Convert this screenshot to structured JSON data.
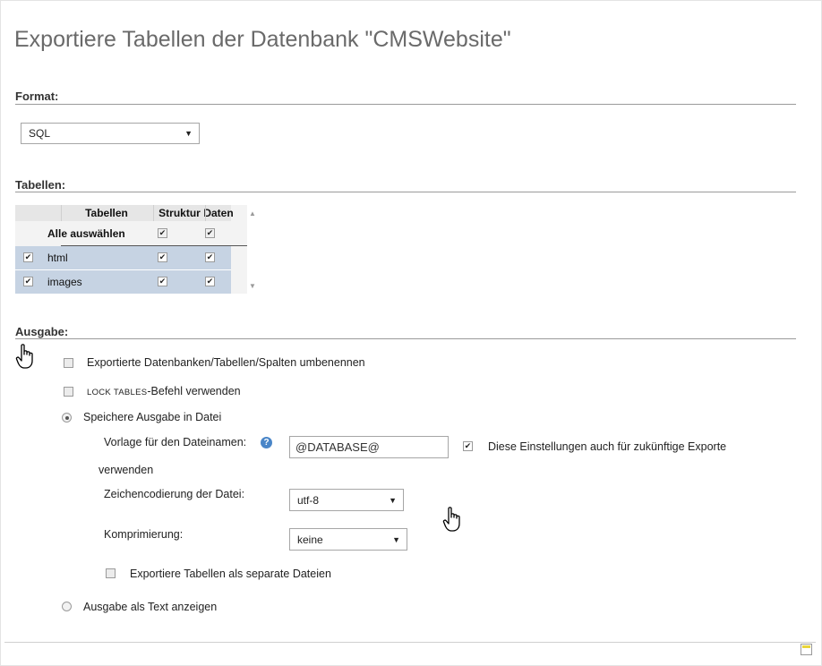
{
  "page": {
    "title": "Exportiere Tabellen der Datenbank \"CMSWebsite\""
  },
  "format": {
    "label": "Format:",
    "selected": "SQL"
  },
  "tables": {
    "label": "Tabellen:",
    "columns": [
      "Tabellen",
      "Struktur",
      "Daten"
    ],
    "select_all_label": "Alle auswählen",
    "rows": [
      {
        "name": "html",
        "selected": true,
        "structure": true,
        "data": true
      },
      {
        "name": "images",
        "selected": true,
        "structure": true,
        "data": true
      }
    ]
  },
  "output": {
    "label": "Ausgabe:",
    "rename_label": "Exportierte Datenbanken/Tabellen/Spalten umbenennen",
    "lock_tables_code": "LOCK TABLES",
    "lock_tables_suffix": "-Befehl verwenden",
    "save_to_file_label": "Speichere Ausgabe in Datei",
    "filename_template_label": "Vorlage für den Dateinamen:",
    "filename_template_value": "@DATABASE@",
    "remember_label_1": "Diese Einstellungen auch für zukünftige Exporte",
    "remember_label_2": "verwenden",
    "charset_label": "Zeichencodierung der Datei:",
    "charset_value": "utf-8",
    "compression_label": "Komprimierung:",
    "compression_value": "keine",
    "separate_files_label": "Exportiere Tabellen als separate Dateien",
    "as_text_label": "Ausgabe als Text anzeigen"
  },
  "icons": {
    "help": "help-icon",
    "cursor": "hand-cursor-icon",
    "corner": "console-icon"
  }
}
